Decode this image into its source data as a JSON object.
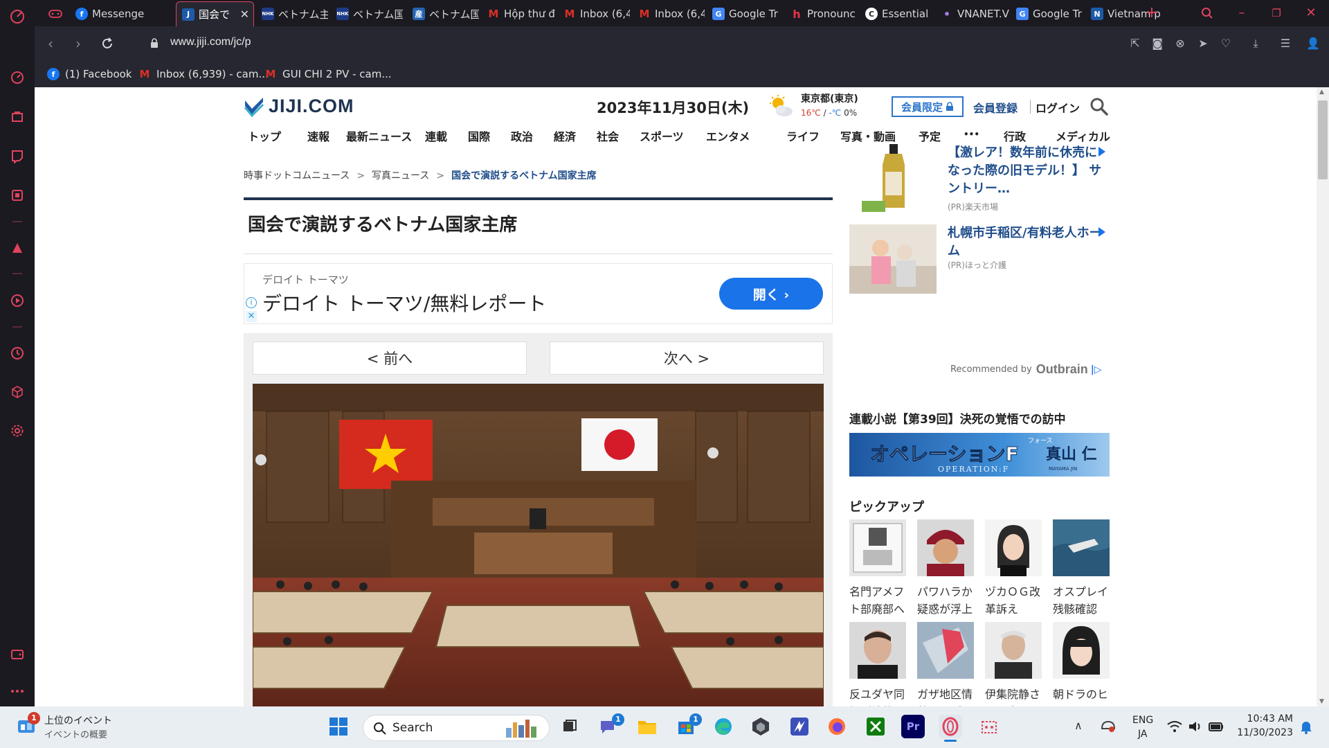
{
  "browser": {
    "tabs": [
      {
        "label": "Messenge",
        "fav_letter": "f",
        "fav_color": "#1877f2"
      },
      {
        "label": "国会で",
        "fav_letter": "J",
        "fav_color": "#1f5aa8"
      },
      {
        "label": "ベトナム主",
        "fav_letter": "NHK",
        "fav_color": "#1d3b86"
      },
      {
        "label": "ベトナム国",
        "fav_letter": "NHK",
        "fav_color": "#1d3b86"
      },
      {
        "label": "ベトナム国",
        "fav_letter": "産",
        "fav_color": "#2563b0"
      },
      {
        "label": "Hộp thư đ",
        "fav_letter": "M",
        "fav_color": "#d93025"
      },
      {
        "label": "Inbox (6,4",
        "fav_letter": "M",
        "fav_color": "#d93025"
      },
      {
        "label": "Inbox (6,4",
        "fav_letter": "M",
        "fav_color": "#d93025"
      },
      {
        "label": "Google Tr",
        "fav_letter": "G",
        "fav_color": "#4285f4"
      },
      {
        "label": "Pronounc",
        "fav_letter": "h",
        "fav_color": "#e5334b"
      },
      {
        "label": "Essential",
        "fav_letter": "C",
        "fav_color": "#333333"
      },
      {
        "label": "VNANET.V",
        "fav_letter": "•",
        "fav_color": "#7a4aa8"
      },
      {
        "label": "Google Tr",
        "fav_letter": "G",
        "fav_color": "#4285f4"
      },
      {
        "label": "Vietnam p",
        "fav_letter": "N",
        "fav_color": "#1c5aa6"
      }
    ],
    "url": "www.jiji.com/jc/p",
    "bookmarks": [
      {
        "label": "(1) Facebook",
        "fav_letter": "f",
        "fav_color": "#1877f2"
      },
      {
        "label": "Inbox (6,939) - cam...",
        "fav_letter": "M",
        "fav_color": "#d93025"
      },
      {
        "label": "GUI CHI 2 PV - cam...",
        "fav_letter": "M",
        "fav_color": "#d93025"
      }
    ],
    "accent_color": "#e0435d"
  },
  "site": {
    "logo_text": "JIJI.COM",
    "date": "2023年11月30日(木)",
    "weather": {
      "city": "東京都(東京)",
      "high": "16℃",
      "slash": " / ",
      "low": "-℃",
      "rain": "0%"
    },
    "member_only": "会員限定",
    "register": "会員登録",
    "login": "ログイン",
    "nav": [
      "トップ",
      "速報",
      "最新ニュース",
      "連載",
      "国際",
      "政治",
      "経済",
      "社会",
      "スポーツ",
      "エンタメ",
      "ライフ",
      "写真・動画",
      "予定",
      "•••",
      "行政",
      "メディカル"
    ]
  },
  "article": {
    "breadcrumb": [
      "時事ドットコムニュース",
      "写真ニュース",
      "国会で演説するベトナム国家主席"
    ],
    "breadcrumb_sep": ">",
    "title": "国会で演説するベトナム国家主席",
    "prev": "< 前へ",
    "next": "次へ >"
  },
  "ad": {
    "company": "デロイト トーマツ",
    "headline": "デロイト トーマツ/無料レポート",
    "button": "開く  ›",
    "info": "i",
    "close": "✕"
  },
  "sidebar_ads": [
    {
      "title": "【激レア！数年前に休売になった際の旧モデル！】 サントリー…",
      "source": "(PR)楽天市場"
    },
    {
      "title": "札幌市手稲区/有料老人ホーム",
      "source": "(PR)ほっと介護"
    }
  ],
  "recommended": {
    "prefix": "Recommended by",
    "brand": "Outbrain"
  },
  "serial": {
    "heading": "連載小説【第39回】決死の覚悟での訪中",
    "banner_title": "オペレーションF",
    "banner_ruby": "フォース",
    "banner_sub": "OPERATION:F",
    "banner_author": "真山 仁",
    "banner_author_en": "MAYAMA JIN"
  },
  "pickup": {
    "heading": "ピックアップ",
    "items": [
      {
        "caption": "名門アメフト部廃部へ"
      },
      {
        "caption": "パワハラか疑惑が浮上"
      },
      {
        "caption": "ヅカＯＧ改革訴え"
      },
      {
        "caption": "オスプレイ残骸確認"
      },
      {
        "caption": "反ユダヤ同調が波紋"
      },
      {
        "caption": "ガザ地区情勢マップ"
      },
      {
        "caption": "伊集院静さん死去"
      },
      {
        "caption": "朝ドラのヒロイン"
      }
    ]
  },
  "taskbar": {
    "widget_title": "上位のイベント",
    "widget_sub": "イベントの概要",
    "widget_badge": "1",
    "search_label": "Search",
    "chat_badge": "1",
    "store_badge": "1",
    "lang_top": "ENG",
    "lang_bottom": "JA",
    "time": "10:43 AM",
    "date": "11/30/2023"
  }
}
